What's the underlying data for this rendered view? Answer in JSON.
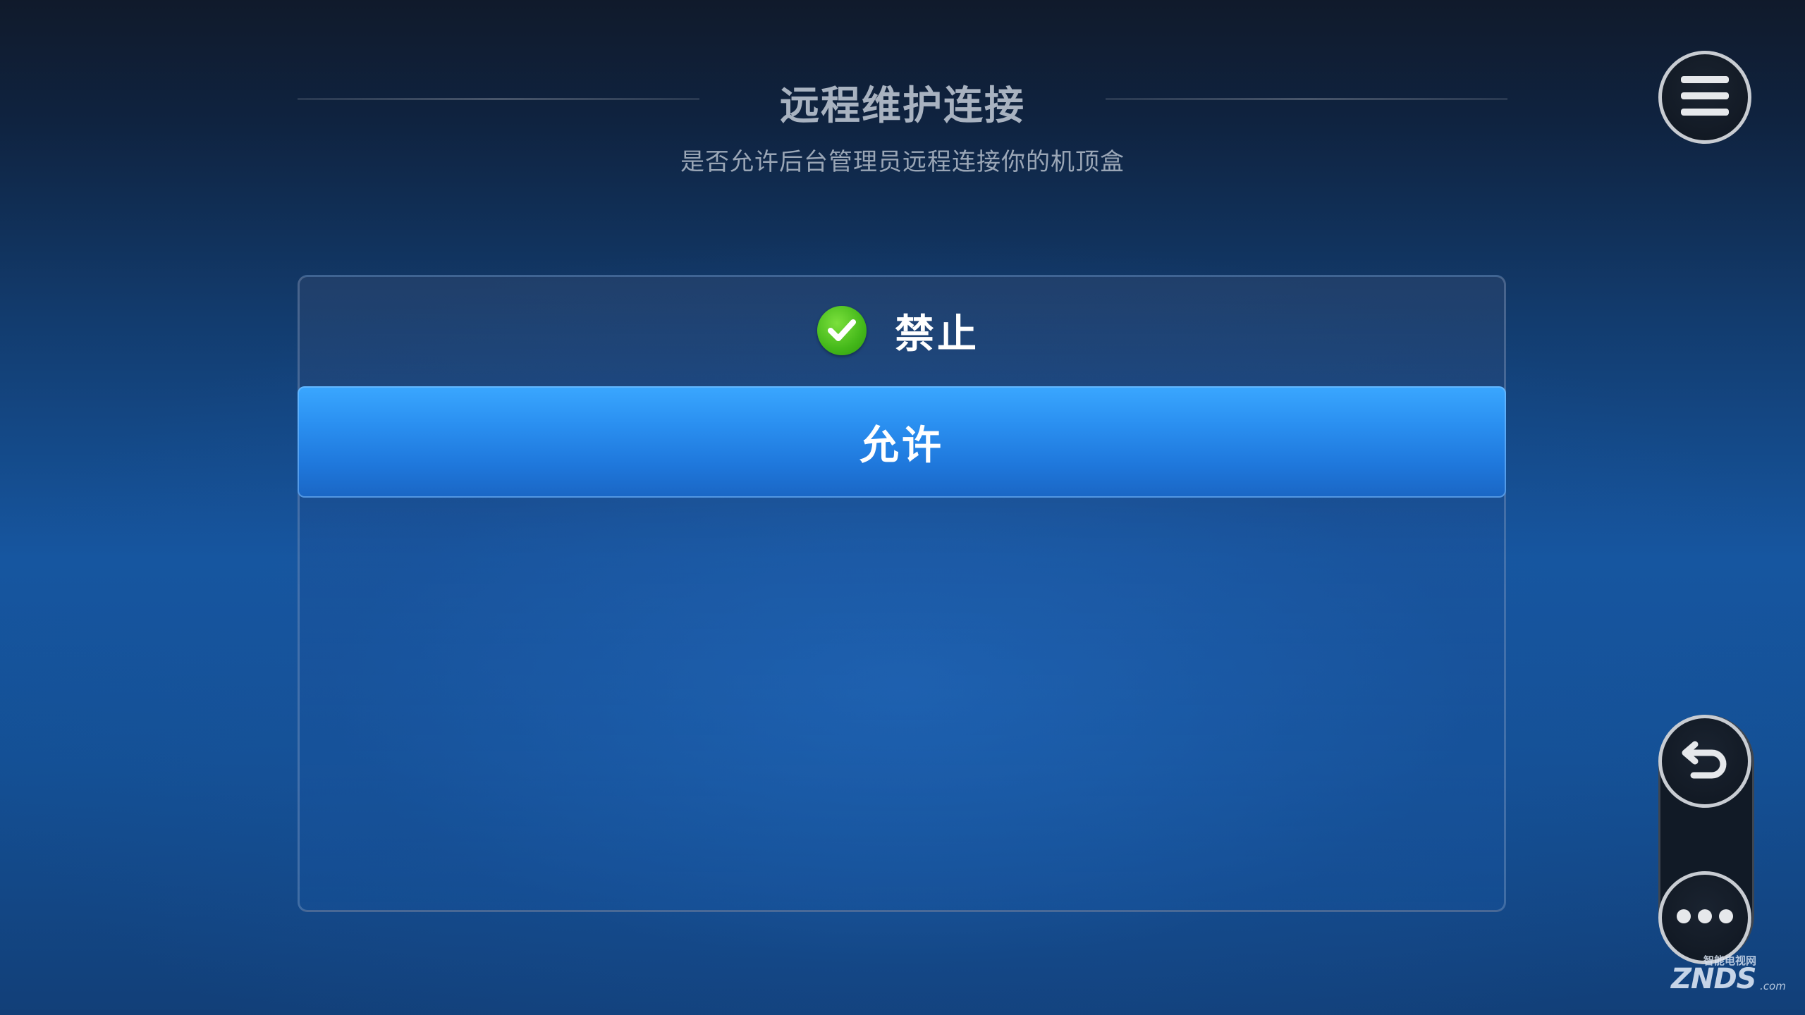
{
  "header": {
    "title": "远程维护连接",
    "subtitle": "是否允许后台管理员远程连接你的机顶盒"
  },
  "options": [
    {
      "label": "禁止",
      "selected": true,
      "icon": "check-circle-icon"
    },
    {
      "label": "允许",
      "focused": true
    }
  ],
  "side_controls": {
    "menu_icon": "hamburger-menu-icon",
    "back_icon": "back-arrow-icon",
    "more_icon": "more-dots-icon"
  },
  "watermark": {
    "small_text": "智能电视网",
    "brand": "ZNDS",
    "domain": ".com"
  },
  "colors": {
    "focus_blue": "#2a8ff0",
    "check_green": "#44b81a",
    "title_gray": "#a8b2c0"
  }
}
